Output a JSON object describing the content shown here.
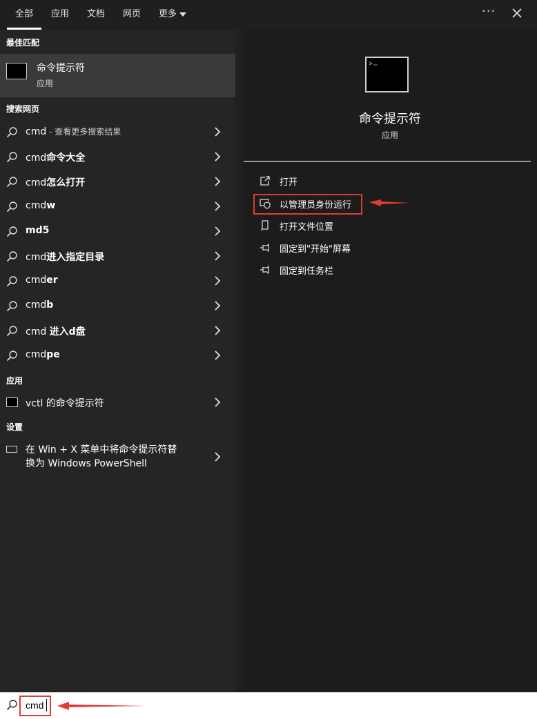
{
  "tabs": [
    {
      "label": "全部",
      "selected": true
    },
    {
      "label": "应用"
    },
    {
      "label": "文档"
    },
    {
      "label": "网页"
    },
    {
      "label": "更多"
    }
  ],
  "sections": {
    "best_match": "最佳匹配",
    "web_search": "搜索网页",
    "apps": "应用",
    "settings": "设置"
  },
  "best_match": {
    "title": "命令提示符",
    "subtitle": "应用"
  },
  "web_results": [
    {
      "prefix": "cmd",
      "bold": "",
      "hint": " - 查看更多搜索结果"
    },
    {
      "prefix": "cmd",
      "bold": "命令大全",
      "hint": ""
    },
    {
      "prefix": "cmd",
      "bold": "怎么打开",
      "hint": ""
    },
    {
      "prefix": "cmd",
      "bold": "w",
      "hint": ""
    },
    {
      "prefix": "",
      "bold": "md5",
      "hint": ""
    },
    {
      "prefix": "cmd",
      "bold": "进入指定目录",
      "hint": ""
    },
    {
      "prefix": "cmd",
      "bold": "er",
      "hint": ""
    },
    {
      "prefix": "cmd",
      "bold": "b",
      "hint": ""
    },
    {
      "prefix": "cmd ",
      "bold": "进入d盘",
      "hint": ""
    },
    {
      "prefix": "cmd",
      "bold": "pe",
      "hint": ""
    }
  ],
  "app_result": {
    "text": "vctl 的命令提示符"
  },
  "settings_result": {
    "line1": "在 Win + X 菜单中将命令提示符替",
    "line2": "换为 Windows PowerShell"
  },
  "detail": {
    "title": "命令提示符",
    "subtitle": "应用",
    "actions": [
      {
        "label": "打开",
        "icon": "open-icon"
      },
      {
        "label": "以管理员身份运行",
        "icon": "shield-admin-icon"
      },
      {
        "label": "打开文件位置",
        "icon": "file-location-icon"
      },
      {
        "label": "固定到\"开始\"屏幕",
        "icon": "pin-icon"
      },
      {
        "label": "固定到任务栏",
        "icon": "pin-icon"
      }
    ]
  },
  "search": {
    "value": "cmd"
  },
  "colors": {
    "highlight": "#e53935",
    "selected_bg": "#3a3a3a"
  }
}
